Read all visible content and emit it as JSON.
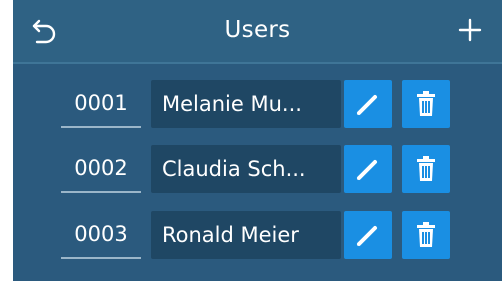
{
  "header": {
    "title": "Users",
    "back_icon": "back-arrow-icon",
    "add_icon": "plus-icon"
  },
  "users": [
    {
      "id": "0001",
      "name": "Melanie Mu..."
    },
    {
      "id": "0002",
      "name": "Claudia Sch..."
    },
    {
      "id": "0003",
      "name": "Ronald Meier"
    }
  ],
  "row_actions": {
    "edit_icon": "pencil-icon",
    "delete_icon": "trash-icon"
  },
  "colors": {
    "background": "#2b5a7e",
    "header": "#2f6284",
    "name_field": "#1f4764",
    "action_button": "#1a8fe3",
    "text": "#ffffff"
  }
}
